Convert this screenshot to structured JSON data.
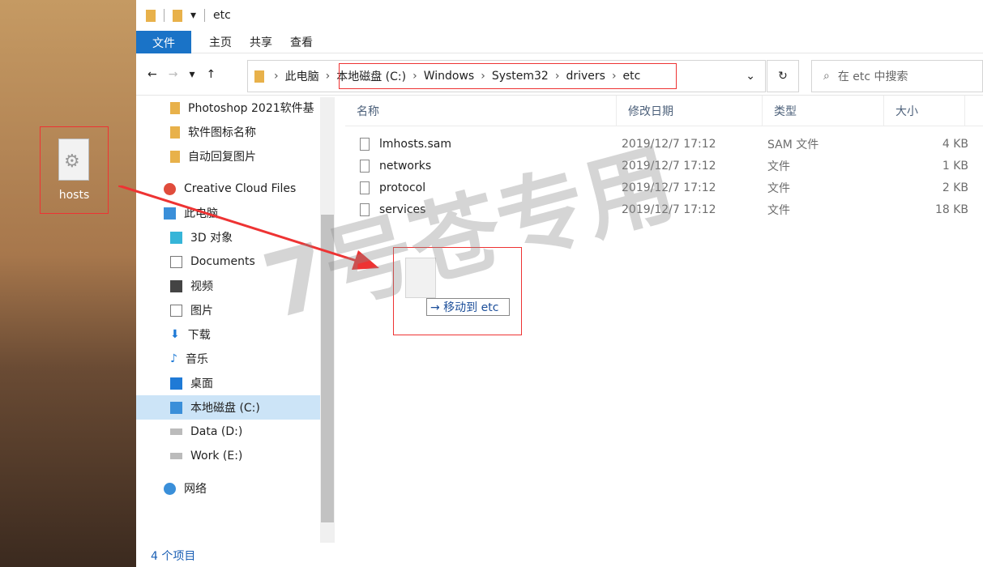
{
  "title": "etc",
  "ribbon": {
    "file": "文件",
    "home": "主页",
    "share": "共享",
    "view": "查看"
  },
  "breadcrumb": [
    "此电脑",
    "本地磁盘 (C:)",
    "Windows",
    "System32",
    "drivers",
    "etc"
  ],
  "search_placeholder": "在 etc 中搜索",
  "sidebar": [
    "Photoshop 2021软件基",
    "软件图标名称",
    "自动回复图片",
    "Creative Cloud Files",
    "此电脑",
    "3D 对象",
    "Documents",
    "视频",
    "图片",
    "下载",
    "音乐",
    "桌面",
    "本地磁盘 (C:)",
    "Data (D:)",
    "Work (E:)",
    "网络"
  ],
  "columns": [
    "名称",
    "修改日期",
    "类型",
    "大小"
  ],
  "files": [
    {
      "name": "lmhosts.sam",
      "date": "2019/12/7 17:12",
      "type": "SAM 文件",
      "size": "4 KB"
    },
    {
      "name": "networks",
      "date": "2019/12/7 17:12",
      "type": "文件",
      "size": "1 KB"
    },
    {
      "name": "protocol",
      "date": "2019/12/7 17:12",
      "type": "文件",
      "size": "2 KB"
    },
    {
      "name": "services",
      "date": "2019/12/7 17:12",
      "type": "文件",
      "size": "18 KB"
    }
  ],
  "status": "4 个项目",
  "drag": {
    "desktop_label": "hosts",
    "tooltip": "→ 移动到 etc"
  },
  "watermark": "7号苍专用"
}
